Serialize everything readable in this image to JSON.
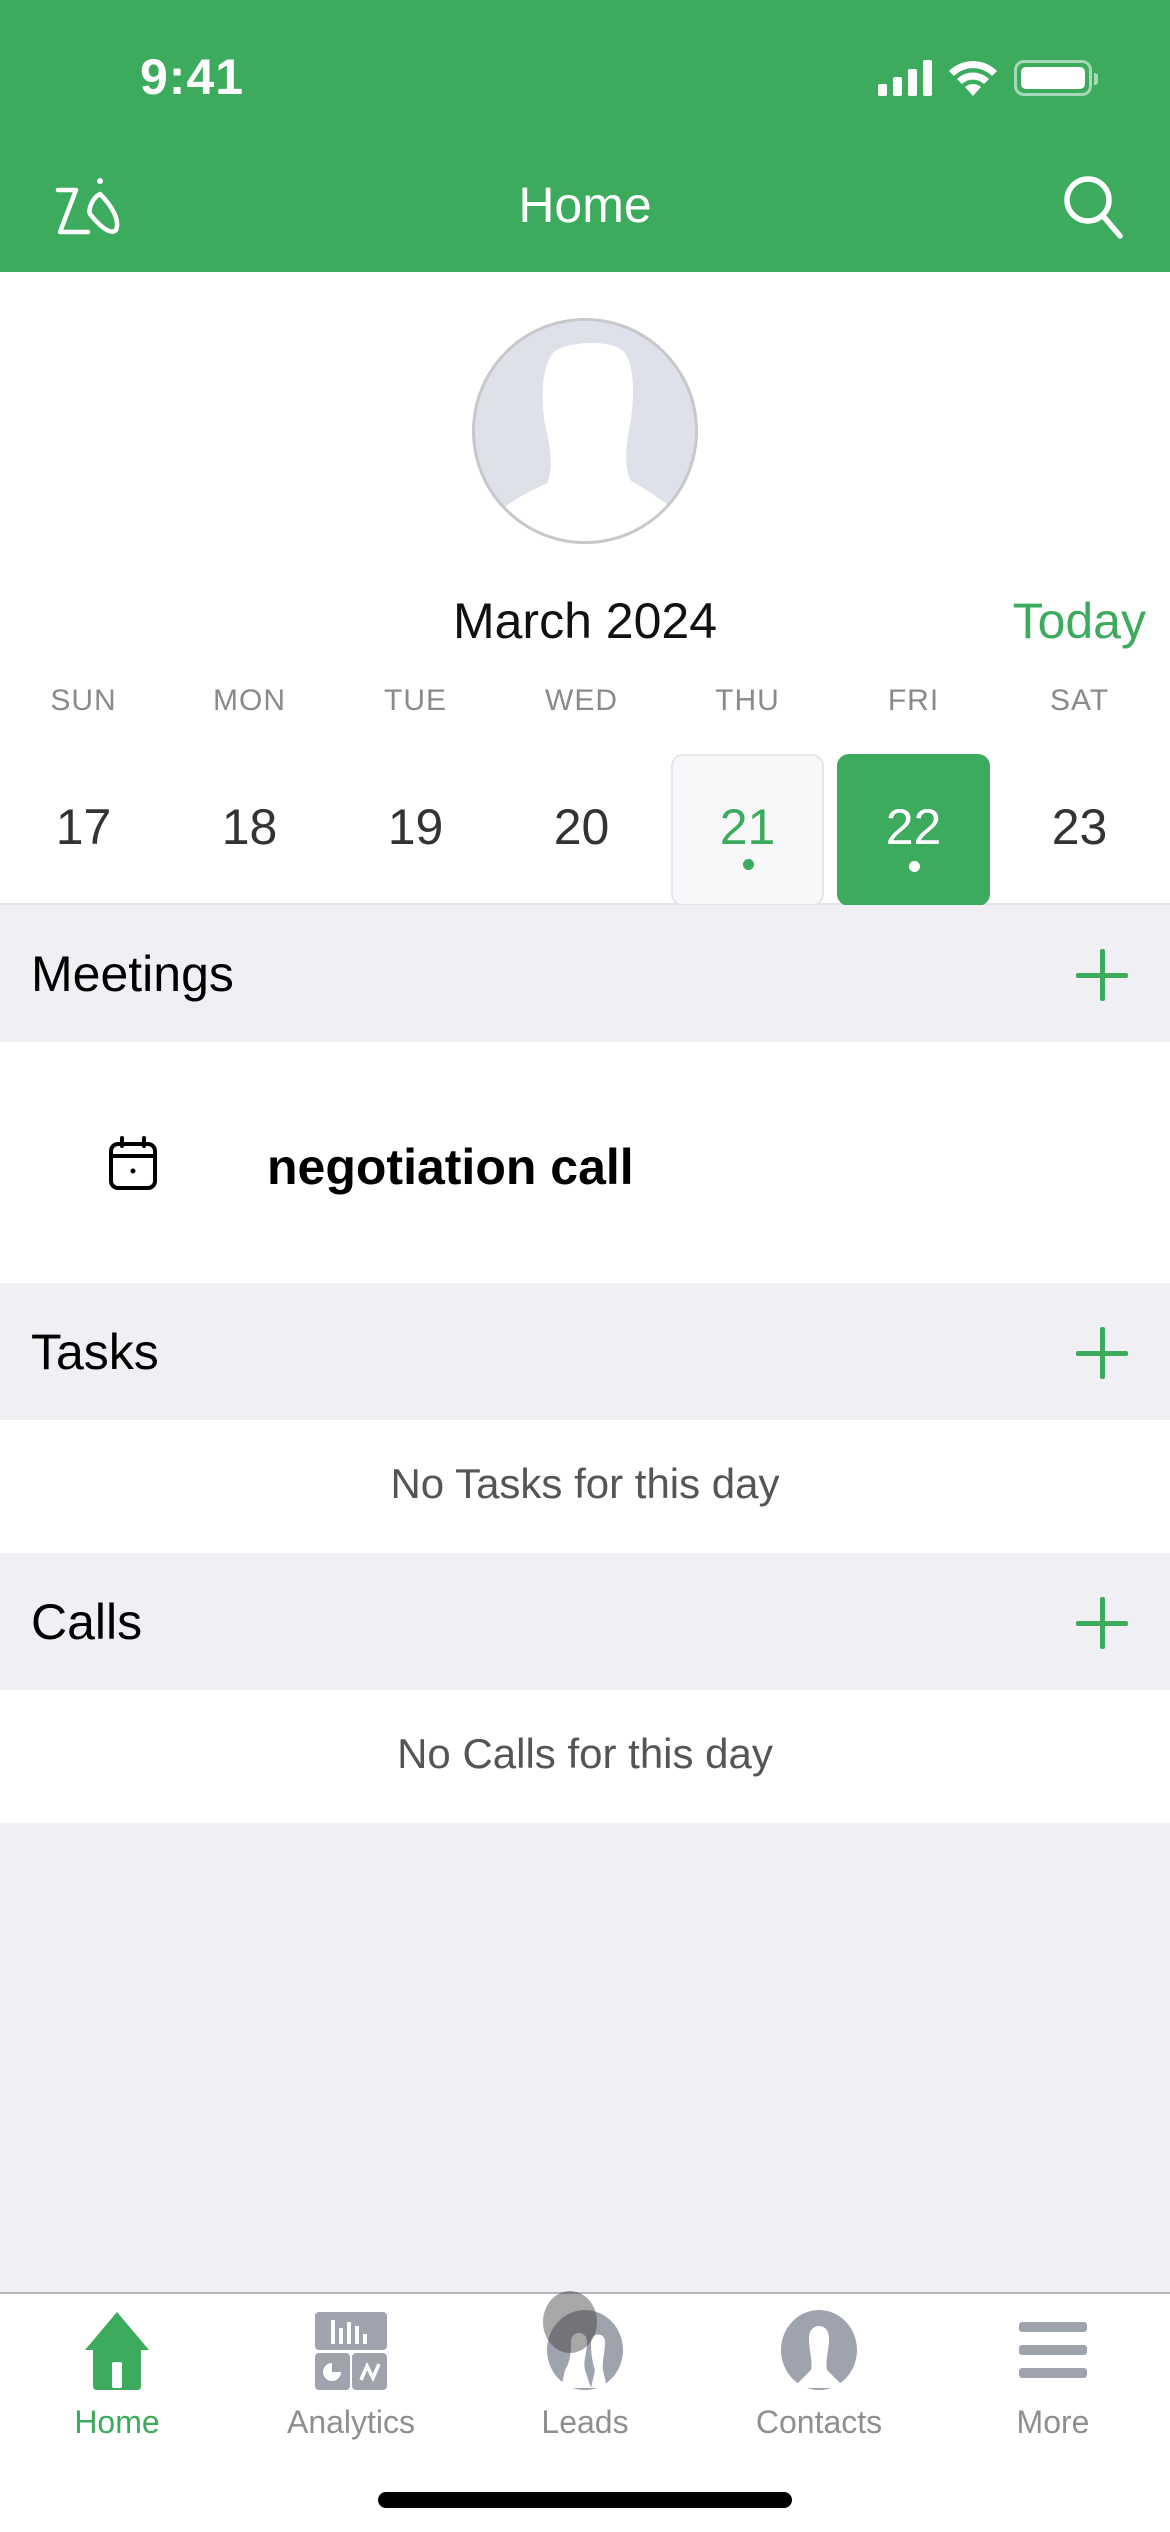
{
  "status_bar": {
    "time": "9:41",
    "signal_icon": "cellular-signal-icon",
    "wifi_icon": "wifi-icon",
    "battery_icon": "battery-icon"
  },
  "nav": {
    "title": "Home",
    "left_icon": "zia-icon",
    "right_icon": "search-icon"
  },
  "profile": {
    "avatar_icon": "default-avatar-icon"
  },
  "calendar": {
    "month_label": "March 2024",
    "today_label": "Today",
    "days": [
      {
        "name": "SUN",
        "date": "17",
        "state": "normal",
        "has_event": false
      },
      {
        "name": "MON",
        "date": "18",
        "state": "normal",
        "has_event": false
      },
      {
        "name": "TUE",
        "date": "19",
        "state": "normal",
        "has_event": false
      },
      {
        "name": "WED",
        "date": "20",
        "state": "normal",
        "has_event": false
      },
      {
        "name": "THU",
        "date": "21",
        "state": "today",
        "has_event": true
      },
      {
        "name": "FRI",
        "date": "22",
        "state": "selected",
        "has_event": true
      },
      {
        "name": "SAT",
        "date": "23",
        "state": "normal",
        "has_event": false
      }
    ]
  },
  "sections": {
    "meetings": {
      "title": "Meetings",
      "items": [
        {
          "title": "negotiation call",
          "icon": "calendar-icon"
        }
      ]
    },
    "tasks": {
      "title": "Tasks",
      "empty_text": "No Tasks for this day"
    },
    "calls": {
      "title": "Calls",
      "empty_text": "No Calls for this day"
    }
  },
  "tabbar": {
    "items": [
      {
        "label": "Home",
        "icon": "home-icon",
        "active": true
      },
      {
        "label": "Analytics",
        "icon": "analytics-icon",
        "active": false
      },
      {
        "label": "Leads",
        "icon": "leads-icon",
        "active": false
      },
      {
        "label": "Contacts",
        "icon": "contacts-icon",
        "active": false
      },
      {
        "label": "More",
        "icon": "more-icon",
        "active": false
      }
    ]
  },
  "colors": {
    "brand": "#3dab5e",
    "inactive": "#8e8e93",
    "section_bg": "#f0eff3"
  }
}
